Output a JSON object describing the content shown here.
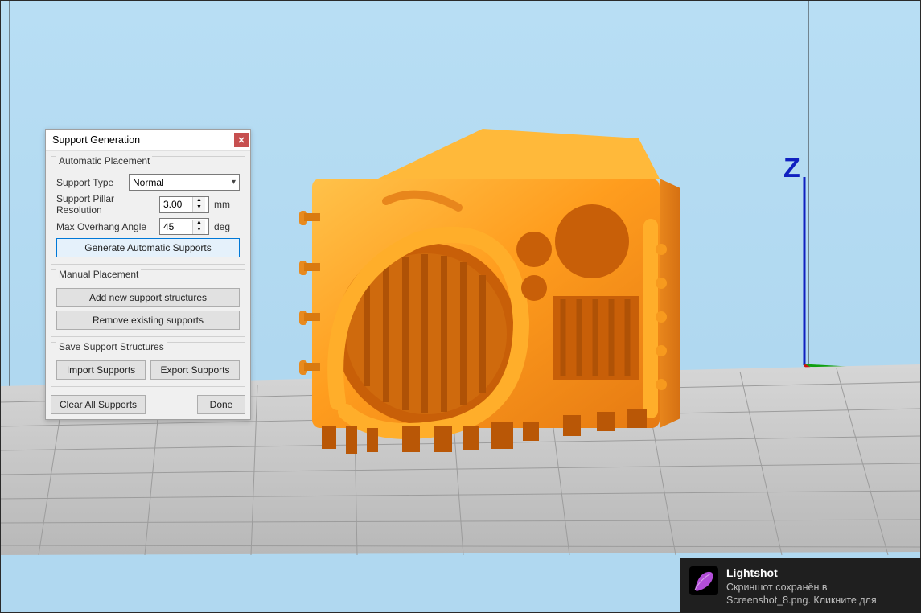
{
  "dialog": {
    "title": "Support Generation",
    "groups": {
      "auto": {
        "title": "Automatic Placement",
        "support_type_label": "Support Type",
        "support_type_value": "Normal",
        "pillar_res_label": "Support Pillar Resolution",
        "pillar_res_value": "3.00",
        "pillar_res_unit": "mm",
        "overhang_label": "Max Overhang Angle",
        "overhang_value": "45",
        "overhang_unit": "deg",
        "generate_btn": "Generate Automatic Supports"
      },
      "manual": {
        "title": "Manual Placement",
        "add_btn": "Add new support structures",
        "remove_btn": "Remove existing supports"
      },
      "save": {
        "title": "Save Support Structures",
        "import_btn": "Import Supports",
        "export_btn": "Export Supports"
      }
    },
    "footer": {
      "clear_btn": "Clear All Supports",
      "done_btn": "Done"
    }
  },
  "toast": {
    "app": "Lightshot",
    "line1": "Скриншот сохранён в",
    "line2": "Screenshot_8.png. Кликните для"
  },
  "axis_label": "Z"
}
